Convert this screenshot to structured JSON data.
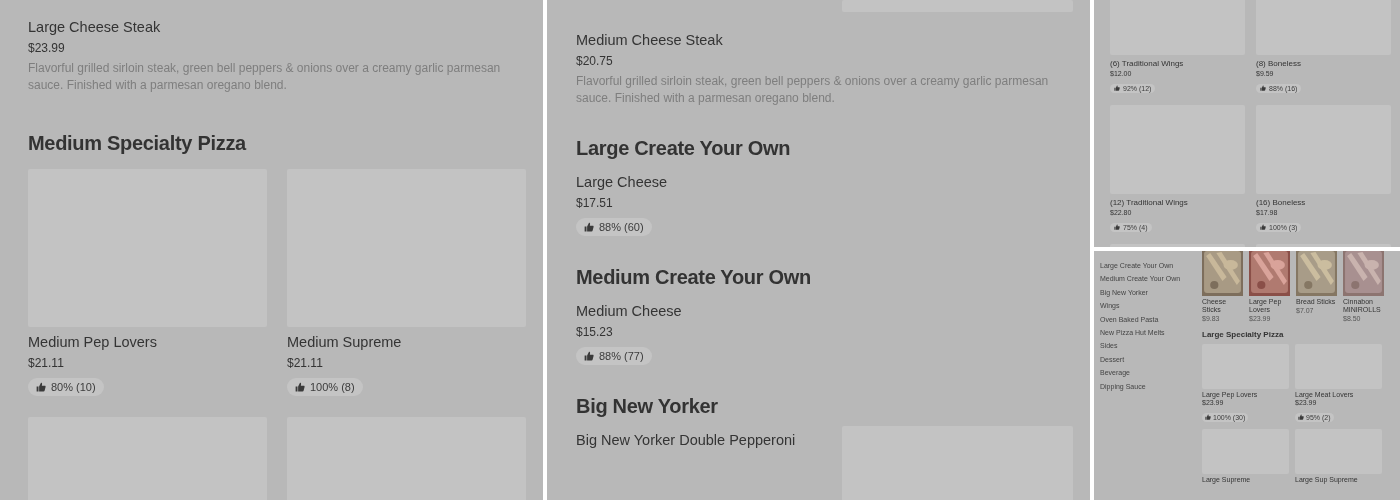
{
  "panels": [
    {
      "sections": [
        {
          "kind": "item",
          "name": "Large Cheese Steak",
          "price": "$23.99",
          "description": "Flavorful grilled sirloin steak, green bell peppers & onions over a creamy garlic parmesan sauce. Finished with a parmesan oregano blend."
        },
        {
          "kind": "heading",
          "title": "Medium Specialty Pizza"
        },
        {
          "kind": "grid",
          "cards": [
            {
              "name": "Medium Pep Lovers",
              "price": "$21.11",
              "rating": "80% (10)"
            },
            {
              "name": "Medium Supreme",
              "price": "$21.11",
              "rating": "100% (8)"
            }
          ]
        },
        {
          "kind": "placeholder-row"
        }
      ]
    },
    {
      "sections": [
        {
          "kind": "stub"
        },
        {
          "kind": "item",
          "name": "Medium Cheese Steak",
          "price": "$20.75",
          "description": "Flavorful grilled sirloin steak, green bell peppers & onions over a creamy garlic parmesan sauce. Finished with a parmesan oregano blend."
        },
        {
          "kind": "heading",
          "title": "Large Create Your Own"
        },
        {
          "kind": "item",
          "name": "Large Cheese",
          "price": "$17.51",
          "rating": "88% (60)"
        },
        {
          "kind": "heading",
          "title": "Medium Create Your Own"
        },
        {
          "kind": "item",
          "name": "Medium Cheese",
          "price": "$15.23",
          "rating": "88% (77)"
        },
        {
          "kind": "heading",
          "title": "Big New Yorker"
        },
        {
          "kind": "item-with-image",
          "name": "Big New Yorker Double Pepperoni"
        }
      ]
    },
    {
      "sections": [
        {
          "kind": "grid",
          "cards": [
            {
              "name": "(6) Traditional Wings",
              "price": "$12.00",
              "rating": "92% (12)"
            },
            {
              "name": "(8) Boneless",
              "price": "$9.59",
              "rating": "88% (16)"
            }
          ]
        },
        {
          "kind": "grid",
          "cards": [
            {
              "name": "(12) Traditional Wings",
              "price": "$22.80",
              "rating": "75% (4)"
            },
            {
              "name": "(16) Boneless",
              "price": "$17.98",
              "rating": "100% (3)"
            }
          ]
        },
        {
          "kind": "placeholder-row"
        }
      ]
    },
    {
      "sidebar": [
        "Large Create Your Own",
        "Medium Create Your Own",
        "Big New Yorker",
        "Wings",
        "Oven Baked Pasta",
        "New Pizza Hut Melts",
        "Sides",
        "Dessert",
        "Beverage",
        "Dipping Sauce"
      ],
      "sections": [
        {
          "kind": "photos",
          "cards": [
            {
              "name": "Cheese Sticks",
              "price": "$9.83"
            },
            {
              "name": "Large Pep Lovers",
              "price": "$23.99"
            },
            {
              "name": "Bread Sticks",
              "price": "$7.07"
            },
            {
              "name": "Cinnabon MINIROLLS",
              "price": "$8.50"
            }
          ]
        },
        {
          "kind": "heading",
          "title": "Large Specialty Pizza"
        },
        {
          "kind": "grid",
          "cards": [
            {
              "name": "Large Pep Lovers",
              "price": "$23.99",
              "rating": "100% (30)"
            },
            {
              "name": "Large Meat Lovers",
              "price": "$23.99",
              "rating": "95% (2)"
            }
          ]
        },
        {
          "kind": "grid",
          "cards": [
            {
              "name": "Large Supreme"
            },
            {
              "name": "Large Sup Supreme"
            }
          ]
        }
      ]
    }
  ]
}
